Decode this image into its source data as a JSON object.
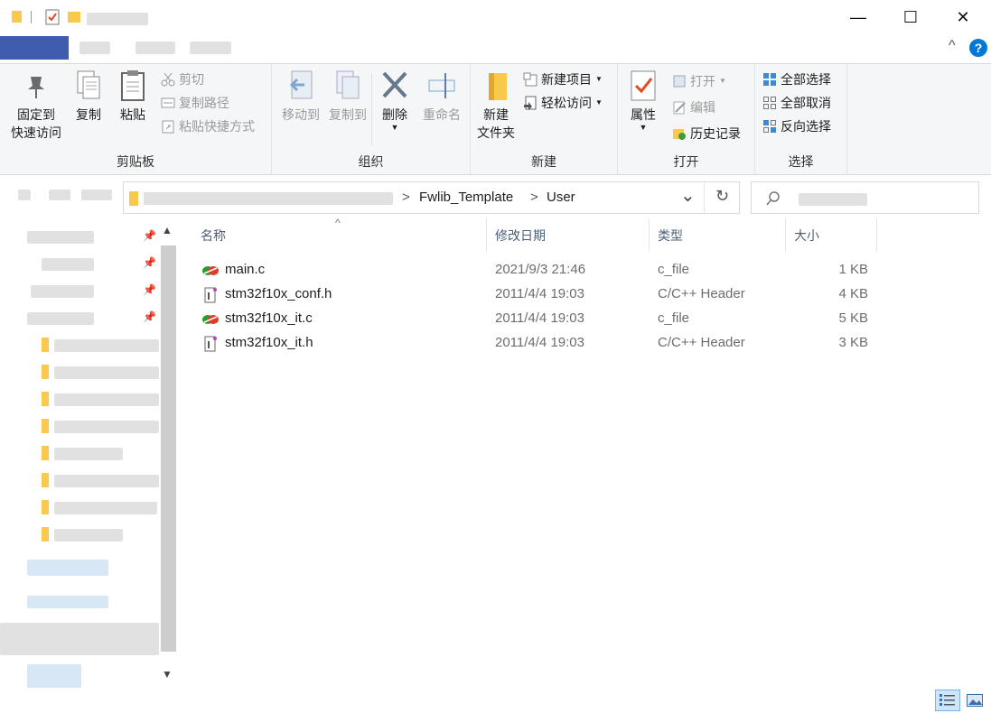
{
  "window": {
    "controls": {
      "minimize": "—",
      "maximize": "☐",
      "close": "✕"
    },
    "help_glyph": "?",
    "collapse_glyph": "^"
  },
  "ribbon": {
    "clipboard": {
      "label": "剪贴板",
      "pin_line1": "固定到",
      "pin_line2": "快速访问",
      "copy": "复制",
      "paste": "粘贴",
      "cut": "剪切",
      "copy_path": "复制路径",
      "paste_shortcut": "粘贴快捷方式"
    },
    "organize": {
      "label": "组织",
      "move_to": "移动到",
      "copy_to": "复制到",
      "delete": "删除",
      "rename": "重命名"
    },
    "new": {
      "label": "新建",
      "new_folder_line1": "新建",
      "new_folder_line2": "文件夹",
      "new_item": "新建项目",
      "easy_access": "轻松访问"
    },
    "open": {
      "label": "打开",
      "properties": "属性",
      "open": "打开",
      "edit": "编辑",
      "history": "历史记录"
    },
    "select": {
      "label": "选择",
      "select_all": "全部选择",
      "select_none": "全部取消",
      "invert": "反向选择"
    }
  },
  "address": {
    "crumbs": [
      "Fwlib_Template",
      "User"
    ],
    "separator": ">",
    "refresh_glyph": "↻",
    "dropdown_glyph": "⌄"
  },
  "columns": {
    "name": "名称",
    "date": "修改日期",
    "type": "类型",
    "size": "大小"
  },
  "files": [
    {
      "name": "main.c",
      "date": "2021/9/3 21:46",
      "type": "c_file",
      "size": "1 KB",
      "icon": "c-file-icon"
    },
    {
      "name": "stm32f10x_conf.h",
      "date": "2011/4/4 19:03",
      "type": "C/C++ Header",
      "size": "4 KB",
      "icon": "header-file-icon"
    },
    {
      "name": "stm32f10x_it.c",
      "date": "2011/4/4 19:03",
      "type": "c_file",
      "size": "5 KB",
      "icon": "c-file-icon"
    },
    {
      "name": "stm32f10x_it.h",
      "date": "2011/4/4 19:03",
      "type": "C/C++ Header",
      "size": "3 KB",
      "icon": "header-file-icon"
    }
  ],
  "colors": {
    "accent": "#0078d7",
    "folder": "#f8c94a",
    "check": "#e8471f"
  }
}
